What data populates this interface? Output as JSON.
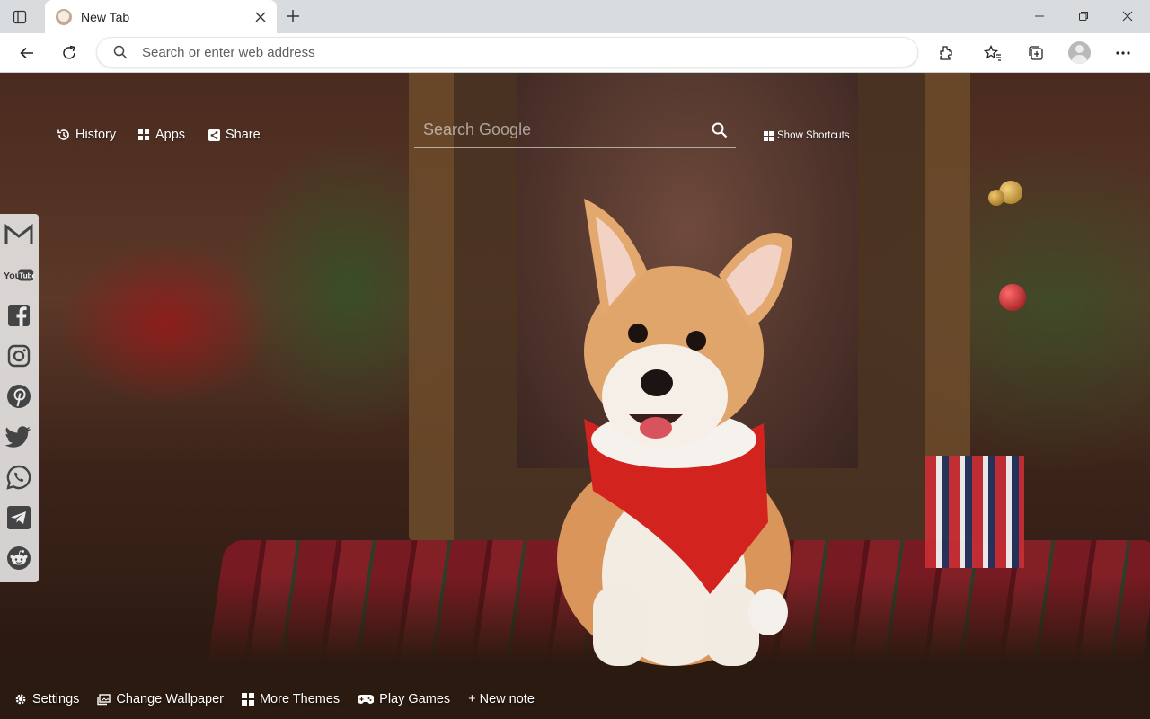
{
  "browser": {
    "tab": {
      "title": "New Tab",
      "favicon": "dog-favicon-icon"
    },
    "omnibox": {
      "placeholder": "Search or enter web address",
      "icon": "search-icon"
    },
    "toolbar_icons": [
      "back-arrow-icon",
      "refresh-icon",
      "extensions-icon",
      "favorites-icon",
      "collections-icon",
      "profile-avatar-icon",
      "more-dots-icon"
    ],
    "window_controls": [
      "minimize-icon",
      "restore-icon",
      "close-icon"
    ]
  },
  "newtab": {
    "links": {
      "history": "History",
      "apps": "Apps",
      "share": "Share"
    },
    "search": {
      "placeholder": "Search Google"
    },
    "show_shortcuts": "Show Shortcuts",
    "social": [
      "Gmail",
      "YouTube",
      "Facebook",
      "Instagram",
      "Pinterest",
      "Twitter",
      "WhatsApp",
      "Telegram",
      "Reddit"
    ],
    "youtube_label": "You",
    "youtube_label_tube": "Tube",
    "bottom": {
      "settings": "Settings",
      "change_wallpaper": "Change Wallpaper",
      "more_themes": "More Themes",
      "play_games": "Play Games",
      "new_note": "+ New note"
    }
  },
  "colors": {
    "tabstrip": "#d9dcdf",
    "toolbar": "#ffffff",
    "social_bg": "#ebebeb",
    "icon_dark": "#333333"
  }
}
